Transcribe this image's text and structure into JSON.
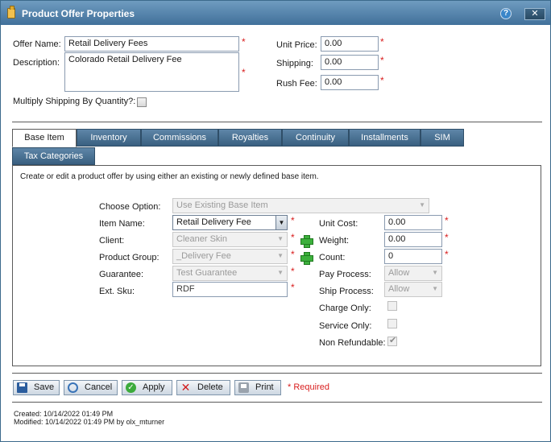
{
  "window": {
    "title": "Product Offer Properties",
    "help_label": "?",
    "close_label": "✕"
  },
  "form": {
    "offer_name_label": "Offer Name:",
    "offer_name_value": "Retail Delivery Fees",
    "description_label": "Description:",
    "description_value": "Colorado Retail Delivery Fee",
    "unit_price_label": "Unit Price:",
    "unit_price_value": "0.00",
    "shipping_label": "Shipping:",
    "shipping_value": "0.00",
    "rush_fee_label": "Rush Fee:",
    "rush_fee_value": "0.00",
    "multiply_label": "Multiply Shipping By Quantity?:",
    "required_mark": "*"
  },
  "tabs": [
    {
      "label": "Base Item",
      "active": true
    },
    {
      "label": "Inventory"
    },
    {
      "label": "Commissions"
    },
    {
      "label": "Royalties"
    },
    {
      "label": "Continuity"
    },
    {
      "label": "Installments"
    },
    {
      "label": "SIM"
    },
    {
      "label": "Tax Categories"
    }
  ],
  "base_item": {
    "description": "Create or edit a product offer by using either an existing or newly defined base item.",
    "choose_option_label": "Choose Option:",
    "choose_option_value": "Use Existing Base Item",
    "item_name_label": "Item Name:",
    "item_name_value": "Retail Delivery Fee",
    "client_label": "Client:",
    "client_value": "Cleaner Skin",
    "product_group_label": "Product Group:",
    "product_group_value": "_Delivery Fee",
    "guarantee_label": "Guarantee:",
    "guarantee_value": "Test Guarantee",
    "ext_sku_label": "Ext. Sku:",
    "ext_sku_value": "RDF",
    "unit_cost_label": "Unit Cost:",
    "unit_cost_value": "0.00",
    "weight_label": "Weight:",
    "weight_value": "0.00",
    "count_label": "Count:",
    "count_value": "0",
    "pay_process_label": "Pay Process:",
    "pay_process_value": "Allow",
    "ship_process_label": "Ship Process:",
    "ship_process_value": "Allow",
    "charge_only_label": "Charge Only:",
    "service_only_label": "Service Only:",
    "non_refundable_label": "Non Refundable:",
    "non_refundable_checked": true
  },
  "buttons": {
    "save": "Save",
    "cancel": "Cancel",
    "apply": "Apply",
    "delete": "Delete",
    "print": "Print",
    "required_note": "* Required"
  },
  "footer": {
    "created": "Created:  10/14/2022 01:49 PM",
    "modified": "Modified:  10/14/2022 01:49 PM  by olx_mturner"
  }
}
